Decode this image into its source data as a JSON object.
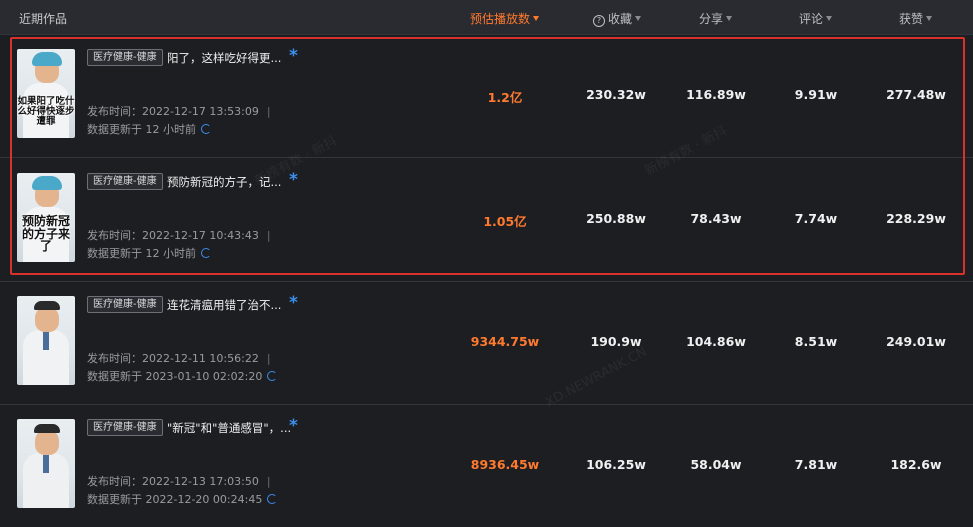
{
  "header": {
    "title": "近期作品",
    "plays": "预估播放数",
    "favorites": "收藏",
    "favorites_icon": "?",
    "shares": "分享",
    "comments": "评论",
    "likes": "获赞"
  },
  "rows": [
    {
      "thumb_caption": "如果阳了吃什么好得快逐步遭罪",
      "tag": "医疗健康-健康",
      "title": "阳了，这样吃好得更...",
      "publish": "发布时间：2022-12-17 13:53:09",
      "update": "数据更新于 12 小时前",
      "plays": "1.2亿",
      "favorites": "230.32w",
      "shares": "116.89w",
      "comments": "9.91w",
      "likes": "277.48w"
    },
    {
      "thumb_caption": "预防新冠的方子来了",
      "tag": "医疗健康-健康",
      "title": "预防新冠的方子，记...",
      "publish": "发布时间：2022-12-17 10:43:43",
      "update": "数据更新于 12 小时前",
      "plays": "1.05亿",
      "favorites": "250.88w",
      "shares": "78.43w",
      "comments": "7.74w",
      "likes": "228.29w"
    },
    {
      "thumb_caption": "",
      "tag": "医疗健康-健康",
      "title": "连花清瘟用错了治不...",
      "publish": "发布时间：2022-12-11 10:56:22",
      "update": "数据更新于 2023-01-10 02:02:20",
      "plays": "9344.75w",
      "favorites": "190.9w",
      "shares": "104.86w",
      "comments": "8.51w",
      "likes": "249.01w"
    },
    {
      "thumb_caption": "",
      "tag": "医疗健康-健康",
      "title": "\"新冠\"和\"普通感冒\"，...",
      "publish": "发布时间：2022-12-13 17:03:50",
      "update": "数据更新于 2022-12-20 00:24:45",
      "plays": "8936.45w",
      "favorites": "106.25w",
      "shares": "58.04w",
      "comments": "7.81w",
      "likes": "182.6w"
    }
  ],
  "watermarks": [
    "新榜有数 · 新抖",
    "XD.NEWRANK.CN"
  ],
  "colors": {
    "accent": "#ff7a2f",
    "highlight": "#d9312b",
    "blue": "#3b8ff0",
    "bg": "#1d1e22"
  }
}
